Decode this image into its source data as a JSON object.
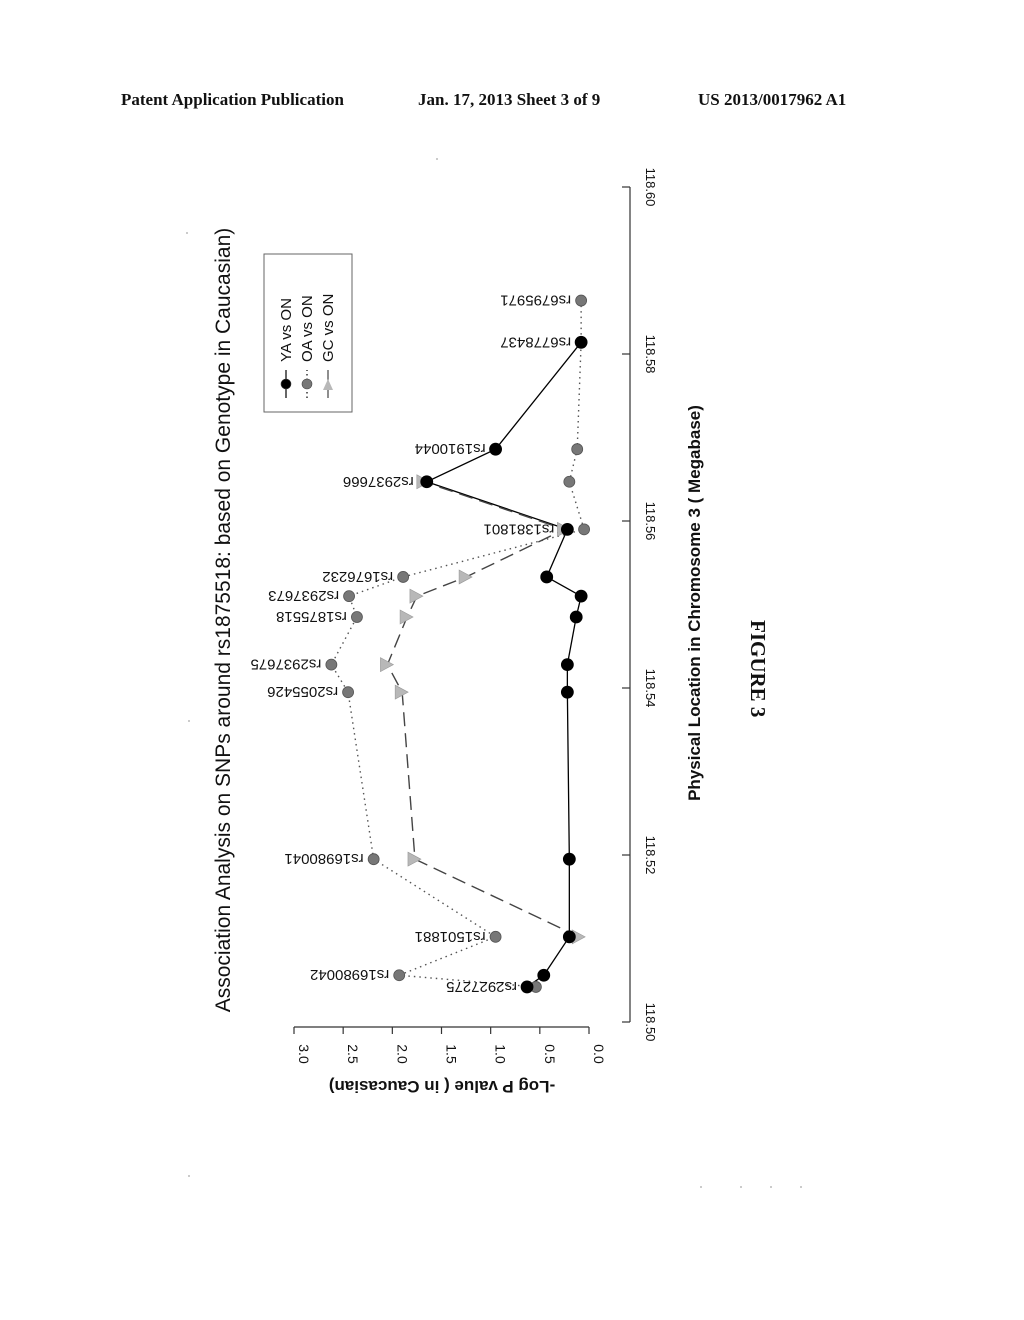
{
  "header": {
    "left": "Patent Application Publication",
    "middle": "Jan. 17, 2013  Sheet 3 of 9",
    "right": "US 2013/0017962 A1"
  },
  "figure_label": "FIGURE 3",
  "chart_data": {
    "type": "line",
    "orientation": "rotated-90",
    "title": "Association Analysis on SNPs around rs1875518: based on Genotype in Caucasian)",
    "xlabel": "Physical Location in Chromosome 3 ( Megabase)",
    "ylabel": "-Log P value ( in Caucasian)",
    "xlim": [
      118.5,
      118.6
    ],
    "ylim": [
      0.0,
      3.0
    ],
    "xticks": [
      "118.50",
      "118.52",
      "118.54",
      "118.56",
      "118.58",
      "118.60"
    ],
    "xtick_values": [
      118.5,
      118.52,
      118.54,
      118.56,
      118.58,
      118.6
    ],
    "yticks": [
      "0.0",
      "0.5",
      "1.0",
      "1.5",
      "2.0",
      "2.5",
      "3.0"
    ],
    "ytick_values": [
      0.0,
      0.5,
      1.0,
      1.5,
      2.0,
      2.5,
      3.0
    ],
    "grid": false,
    "legend_position": "top-right",
    "snps": [
      {
        "label": "rs2927275",
        "x": 118.5042
      },
      {
        "label": "rs16980042",
        "x": 118.5056
      },
      {
        "label": "rs1501881",
        "x": 118.5102
      },
      {
        "label": "rs16980041",
        "x": 118.5195
      },
      {
        "label": "rs2055426",
        "x": 118.5395
      },
      {
        "label": "rs2937675",
        "x": 118.5428
      },
      {
        "label": "rs1875518",
        "x": 118.5485
      },
      {
        "label": "rs2937673",
        "x": 118.551
      },
      {
        "label": "rs1676232",
        "x": 118.5533
      },
      {
        "label": "rs1381801",
        "x": 118.559
      },
      {
        "label": "rs2937666",
        "x": 118.5647
      },
      {
        "label": "rs1910044",
        "x": 118.5686
      },
      {
        "label": "rs6778437",
        "x": 118.5814
      },
      {
        "label": "rs6795971",
        "x": 118.5864
      }
    ],
    "series": [
      {
        "name": "YA vs ON",
        "style": "solid",
        "marker": "circle",
        "color": "#000000",
        "points": [
          [
            118.5042,
            0.63
          ],
          [
            118.5056,
            0.46
          ],
          [
            118.5102,
            0.2
          ],
          [
            118.5195,
            0.2
          ],
          [
            118.5395,
            0.22
          ],
          [
            118.5428,
            0.22
          ],
          [
            118.5485,
            0.13
          ],
          [
            118.551,
            0.08
          ],
          [
            118.5533,
            0.43
          ],
          [
            118.559,
            0.22
          ],
          [
            118.5647,
            1.65
          ],
          [
            118.5686,
            0.95
          ],
          [
            118.5814,
            0.08
          ]
        ]
      },
      {
        "name": "OA vs ON",
        "style": "dotted",
        "marker": "circle",
        "color": "#777777",
        "points": [
          [
            118.5042,
            0.54
          ],
          [
            118.5056,
            1.93
          ],
          [
            118.5102,
            0.95
          ],
          [
            118.5195,
            2.19
          ],
          [
            118.5395,
            2.45
          ],
          [
            118.5428,
            2.62
          ],
          [
            118.5485,
            2.36
          ],
          [
            118.551,
            2.44
          ],
          [
            118.5533,
            1.89
          ],
          [
            118.559,
            0.05
          ],
          [
            118.5647,
            0.2
          ],
          [
            118.5686,
            0.12
          ],
          [
            118.5814,
            0.08
          ],
          [
            118.5864,
            0.08
          ]
        ]
      },
      {
        "name": "GC vs ON",
        "style": "dashed",
        "marker": "triangle",
        "color": "#b8b8b8",
        "points": [
          [
            118.5102,
            0.1
          ],
          [
            118.5195,
            1.77
          ],
          [
            118.5395,
            1.9
          ],
          [
            118.5428,
            2.05
          ],
          [
            118.5485,
            1.85
          ],
          [
            118.551,
            1.75
          ],
          [
            118.5533,
            1.25
          ],
          [
            118.559,
            0.25
          ],
          [
            118.5647,
            1.68
          ]
        ]
      }
    ]
  }
}
